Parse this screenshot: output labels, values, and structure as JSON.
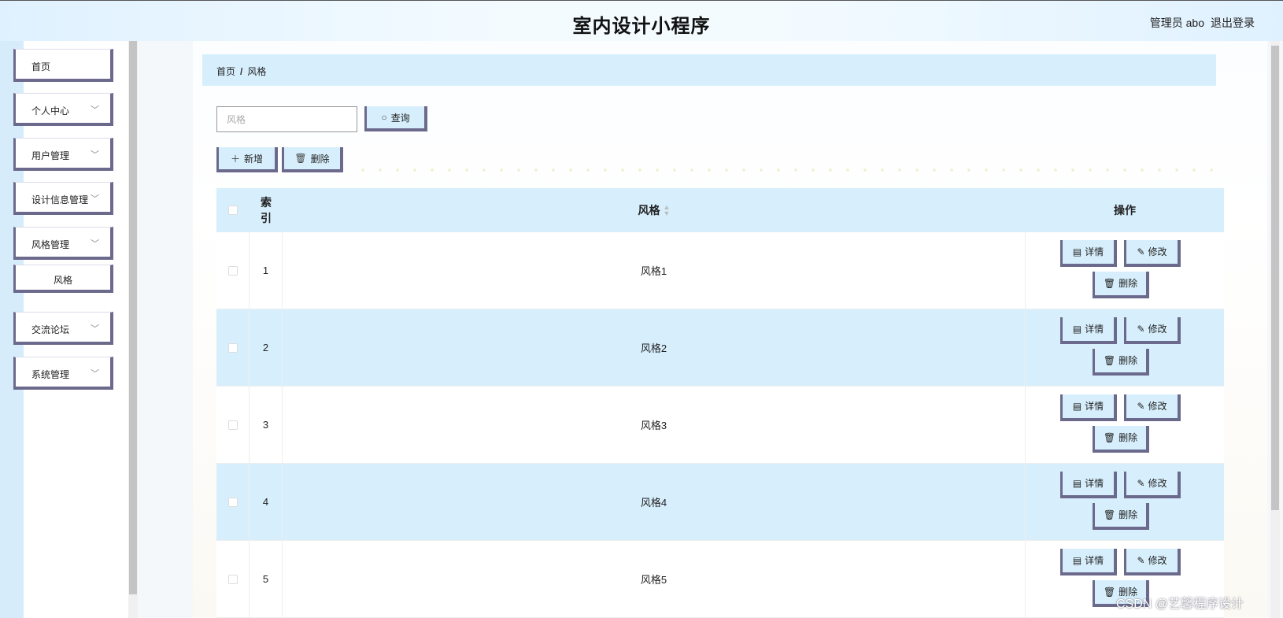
{
  "header": {
    "title": "室内设计小程序",
    "user": "管理员 abo",
    "logout": "退出登录"
  },
  "sidebar": {
    "items": [
      {
        "label": "首页",
        "has_children": false
      },
      {
        "label": "个人中心",
        "has_children": true
      },
      {
        "label": "用户管理",
        "has_children": true
      },
      {
        "label": "设计信息管理",
        "has_children": true
      },
      {
        "label": "风格管理",
        "has_children": true,
        "expanded": true
      },
      {
        "label": "交流论坛",
        "has_children": true
      },
      {
        "label": "系统管理",
        "has_children": true
      }
    ],
    "subitem": "风格",
    "chevron": "chevron-down-icon"
  },
  "breadcrumb": {
    "home": "首页",
    "separator": "/",
    "current": "风格"
  },
  "search": {
    "placeholder": "风格",
    "button_label": "查询"
  },
  "toolbar": {
    "add_label": "新增",
    "delete_label": "删除"
  },
  "table": {
    "headers": {
      "index": "索引",
      "style": "风格",
      "ops": "操作"
    },
    "rows": [
      {
        "index": "1",
        "style": "风格1"
      },
      {
        "index": "2",
        "style": "风格2"
      },
      {
        "index": "3",
        "style": "风格3"
      },
      {
        "index": "4",
        "style": "风格4"
      },
      {
        "index": "5",
        "style": "风格5"
      }
    ],
    "op_labels": {
      "detail": "详情",
      "edit": "修改",
      "delete": "删除"
    }
  },
  "watermark": "CSDN @艺馨程序设计",
  "colors": {
    "accent_light": "#d7effd",
    "button_border": "#6b6a8c"
  }
}
